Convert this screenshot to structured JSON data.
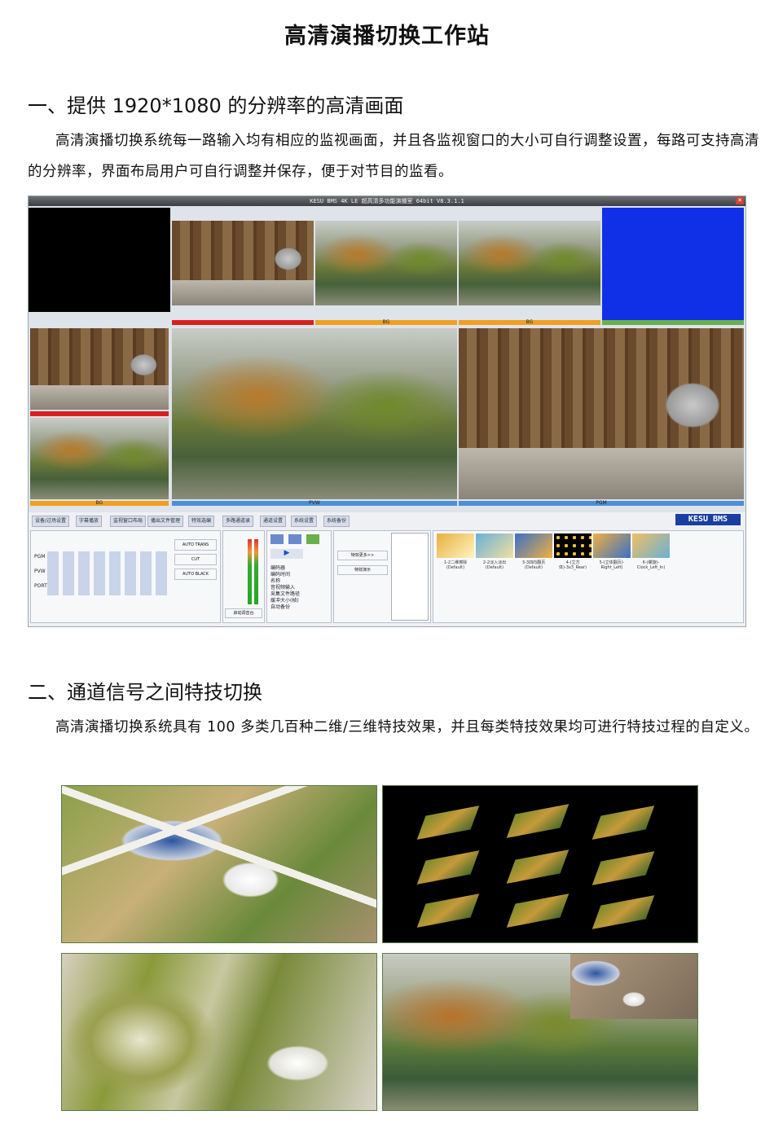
{
  "title": "高清演播切换工作站",
  "section1": {
    "heading": "一、提供 1920*1080 的分辨率的高清画面",
    "paragraph": "高清演播切换系统每一路输入均有相应的监视画面，并且各监视窗口的大小可自行调整设置，每路可支持高清的分辨率，界面布局用户可自行调整并保存，便于对节目的监看。"
  },
  "screenshot": {
    "window_title": "KESU BMS 4K LE 超高清多功能演播室 64bit V8.3.1.1",
    "brand": "KESU BMS",
    "monitor_labels": [
      "BG",
      "BG",
      "BG",
      "PVW",
      "PGM"
    ],
    "toolbar": [
      "设备/过场设置",
      "字幕播放",
      "监视窗口布局",
      "播出文件管理",
      "特效选编",
      "多路通道录",
      "通道设置",
      "系统设置",
      "系统备份"
    ],
    "switch_rows": [
      "PGM",
      "PVW",
      "PORT"
    ],
    "buttons": [
      "AUTO TRANS",
      "CUT",
      "AUTO BLACK",
      "特效更多>>",
      "特效演示",
      "启动调音台"
    ],
    "effect_list": [
      "1-2二维擦除(Default)",
      "2-2淡入淡出(Default)",
      "3-3四向翻页(Default)",
      "4-(立方体)-3x3_Rear)",
      "5-(立体翻页)-Right_Left)",
      "6-(螺旋)-Clock_Left_In)"
    ],
    "info_items": [
      "编码器",
      "编码时间",
      "名称",
      "音视频输入",
      "采集文件路径",
      "缓冲大小(帧)",
      "自动备份"
    ]
  },
  "section2": {
    "heading": "二、通道信号之间特技切换",
    "paragraph": "高清演播切换系统具有 100 多类几百种二维/三维特技效果，并且每类特技效果均可进行特技过程的自定义。"
  }
}
